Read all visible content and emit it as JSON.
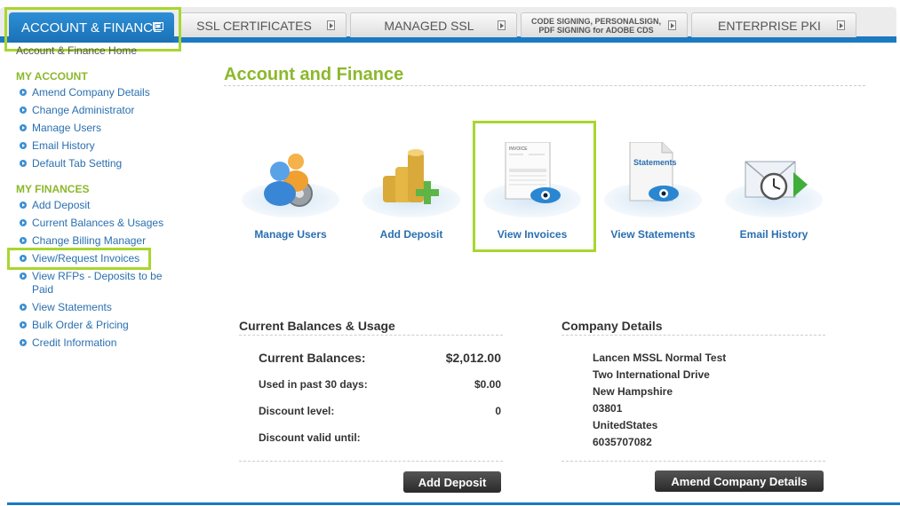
{
  "tabs": [
    {
      "label": "ACCOUNT & FINANCE"
    },
    {
      "label": "SSL CERTIFICATES"
    },
    {
      "label": "MANAGED SSL"
    },
    {
      "label": "CODE SIGNING, PERSONALSIGN,\nPDF SIGNING for ADOBE CDS"
    },
    {
      "label": "ENTERPRISE PKI"
    }
  ],
  "sidebar": {
    "cut_link": "Account & Finance Home",
    "my_account_heading": "MY ACCOUNT",
    "my_account_items": [
      "Amend Company Details",
      "Change Administrator",
      "Manage Users",
      "Email History",
      "Default Tab Setting"
    ],
    "my_finances_heading": "MY FINANCES",
    "my_finances_items": [
      "Add Deposit",
      "Current Balances & Usages",
      "Change Billing Manager",
      "View/Request Invoices",
      "View RFPs - Deposits to be Paid",
      "View Statements",
      "Bulk Order & Pricing",
      "Credit Information"
    ]
  },
  "main": {
    "title": "Account and Finance",
    "icons": [
      {
        "label": "Manage Users",
        "icon": "users-gear-icon"
      },
      {
        "label": "Add Deposit",
        "icon": "coins-plus-icon"
      },
      {
        "label": "View Invoices",
        "icon": "invoice-eye-icon"
      },
      {
        "label": "View Statements",
        "icon": "statement-eye-icon"
      },
      {
        "label": "Email History",
        "icon": "envelope-clock-icon"
      }
    ],
    "invoice_doc_text": "INVOICE",
    "statement_doc_text": "Statements",
    "balances": {
      "title": "Current Balances & Usage",
      "current_label": "Current Balances:",
      "current_value": "$2,012.00",
      "used_label": "Used in past 30 days:",
      "used_value": "$0.00",
      "discount_label": "Discount level:",
      "discount_value": "0",
      "discount_valid_label": "Discount valid until:",
      "discount_valid_value": "",
      "button": "Add Deposit"
    },
    "company": {
      "title": "Company Details",
      "lines": [
        "Lancen MSSL Normal Test",
        "Two International Drive",
        "New Hampshire",
        "03801",
        "UnitedStates",
        "6035707082"
      ],
      "button": "Amend Company Details"
    }
  },
  "colors": {
    "accent_green": "#8cb82c",
    "highlight_green": "#a9d62f",
    "brand_blue": "#1b7ac2",
    "link_blue": "#2a6fb0"
  }
}
